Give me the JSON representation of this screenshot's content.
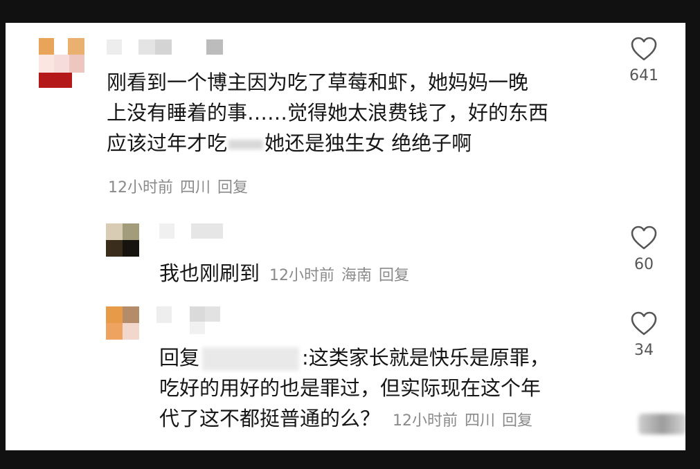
{
  "colors": {
    "background": "#111111",
    "panel": "#ffffff",
    "text": "#161616",
    "meta": "#8a8a8a"
  },
  "comments": [
    {
      "lines": [
        "刚看到一个博主因为吃了草莓和虾，她妈妈一晚",
        "上没有睡着的事……觉得她太浪费钱了，好的东西",
        "应该过年才吃",
        "她还是独生女 绝绝子啊"
      ],
      "time": "12小时前",
      "location": "四川",
      "reply": "回复",
      "likes": "641",
      "like_icon": "heart-outline-icon"
    },
    {
      "text": "我也刚刷到",
      "time": "12小时前",
      "location": "海南",
      "reply": "回复",
      "likes": "60",
      "like_icon": "heart-outline-icon"
    },
    {
      "lines": [
        "回复",
        ":这类家长就是快乐是原罪，",
        "吃好的用好的也是罪过，但实际现在这个年",
        "代了这不都挺普通的么？"
      ],
      "time": "12小时前",
      "location": "四川",
      "reply": "回复",
      "likes": "34",
      "like_icon": "heart-outline-icon"
    }
  ]
}
